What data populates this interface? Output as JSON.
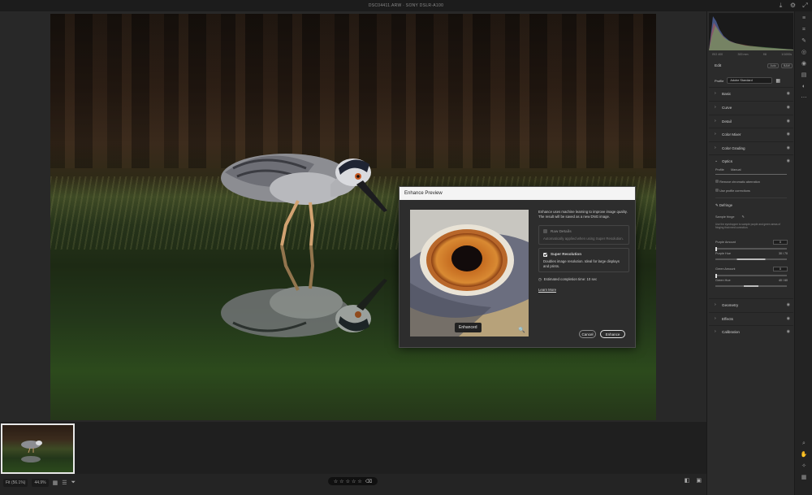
{
  "window": {
    "title": "DSC04411.ARW  ·  SONY DSLR-A100"
  },
  "dialog": {
    "title": "Enhance Preview",
    "intro": "Enhance uses machine learning to improve image quality. The result will be saved as a new DNG image.",
    "raw_details": {
      "label": "Raw Details",
      "desc": "Automatically applied when using Super Resolution.",
      "checked": true,
      "enabled": false
    },
    "super_resolution": {
      "label": "Super Resolution",
      "desc": "Doubles image resolution. Ideal for large displays and prints.",
      "checked": true
    },
    "estimate": "Estimated completion time: 10 sec",
    "learn_more": "Learn More",
    "badge": "Enhanced",
    "cancel_label": "Cancel",
    "enhance_label": "Enhance"
  },
  "right_panel": {
    "camera_info": [
      "ISO 400",
      "300 mm",
      "f/8",
      "1/1000s"
    ],
    "edit_label": "Edit",
    "auto_label": "Auto",
    "bw_label": "B&W",
    "profile_label": "Profile",
    "profile_value": "Adobe Standard",
    "sections": [
      "Basic",
      "Curve",
      "Detail",
      "Color Mixer",
      "Color Grading",
      "Optics"
    ],
    "optics_tabs": [
      "Profile",
      "Manual"
    ],
    "remove_ca": "Remove chromatic aberration",
    "use_profile": "Use profile corrections",
    "defringe": "Defringe",
    "sample_fringe": "Sample fringe",
    "defringe_hint": "Use the eyedropper to sample purple and green areas of fringing that need correction.",
    "purple_amount": {
      "label": "Purple Amount",
      "value": "0"
    },
    "purple_hue": {
      "label": "Purple Hue",
      "value": "30 / 70"
    },
    "green_amount": {
      "label": "Green Amount",
      "value": "0"
    },
    "green_hue": {
      "label": "Green Hue",
      "value": "40 / 60"
    },
    "lower_sections": [
      "Geometry",
      "Effects",
      "Calibration"
    ]
  },
  "bottom_bar": {
    "fit_label": "Fit (56.1%)",
    "zoom_label": "44.9%",
    "rating_stars": 5
  },
  "colors": {
    "accent": "#e8e8e8",
    "panel": "#2b2b2b",
    "dialog": "#2d2d2d"
  }
}
